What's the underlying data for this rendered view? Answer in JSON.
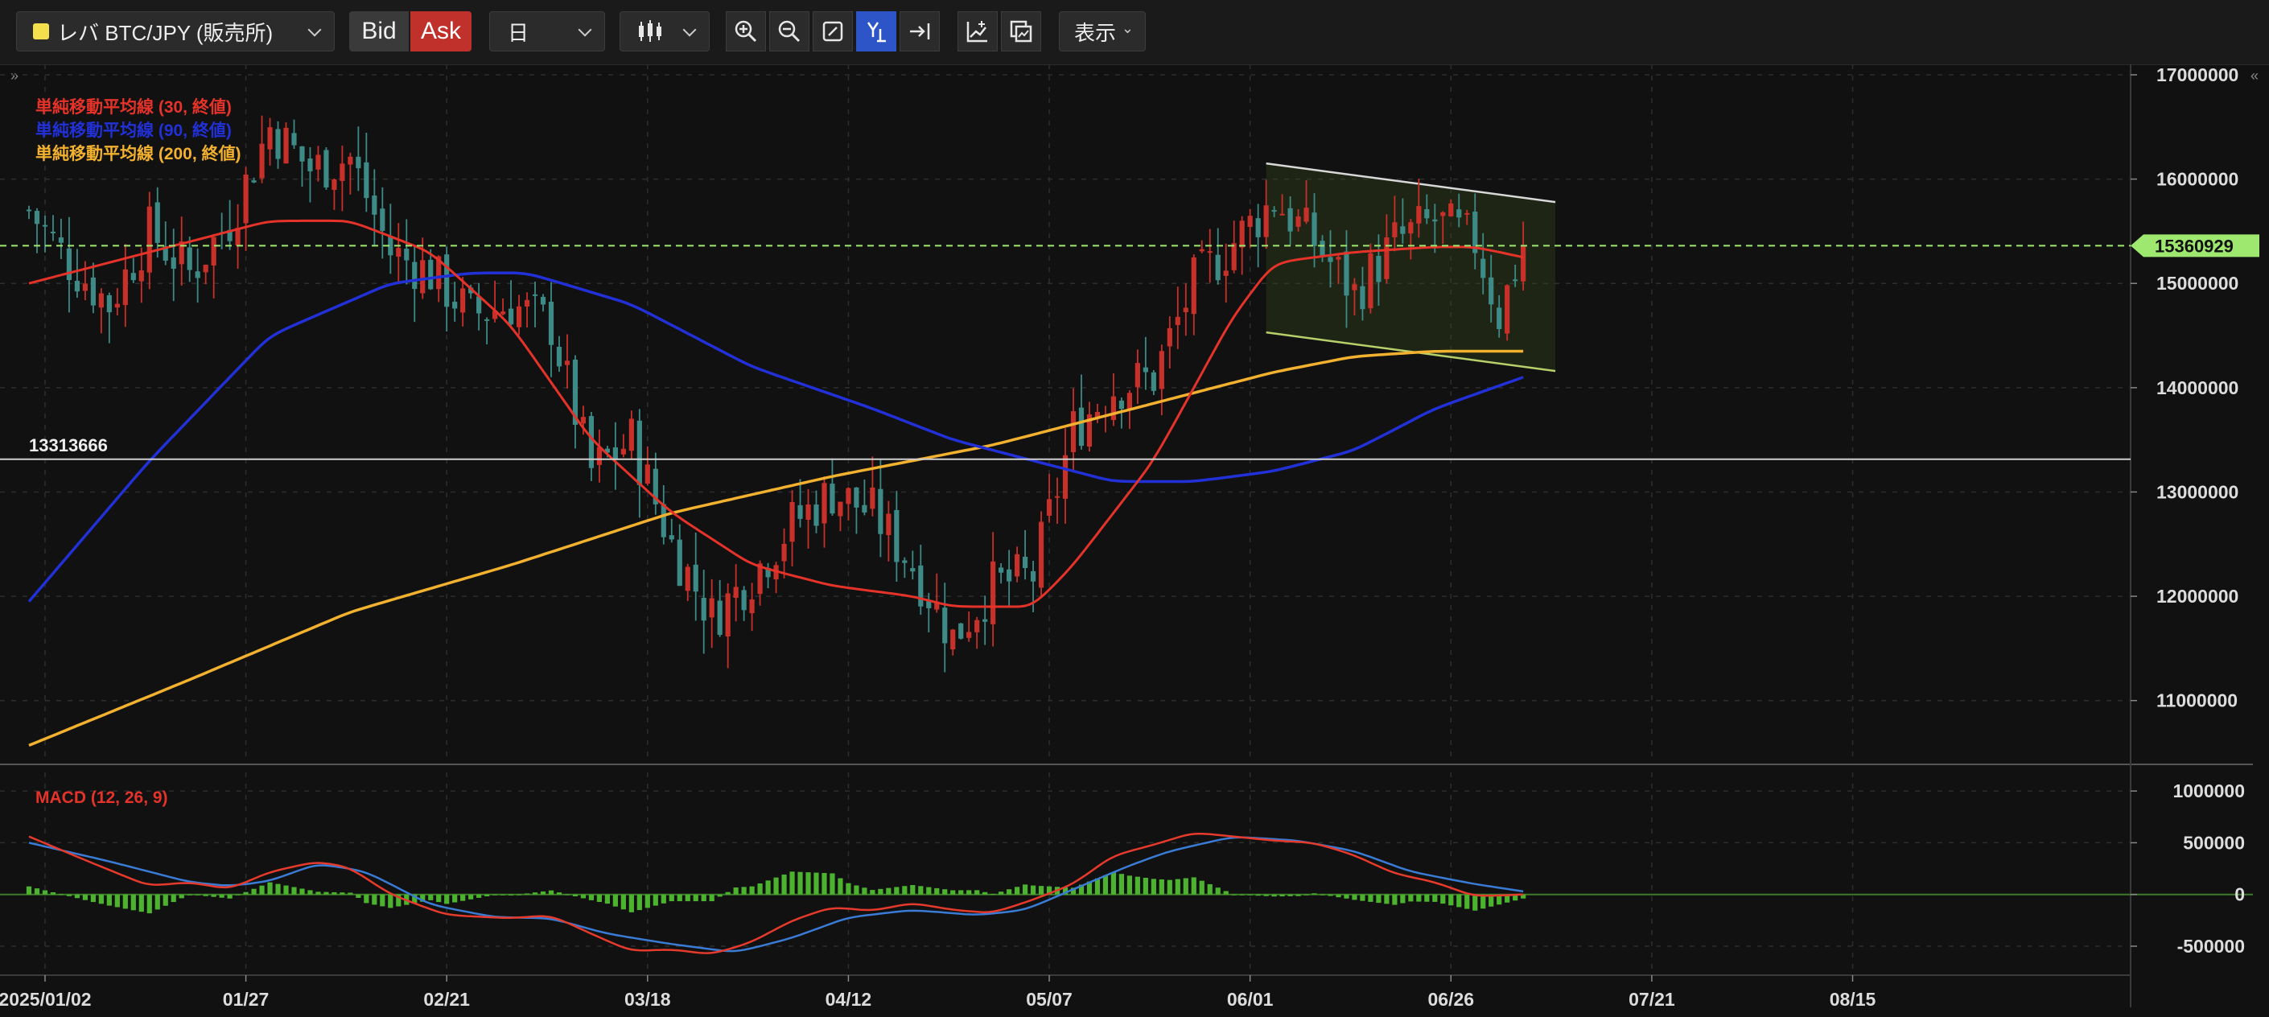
{
  "toolbar": {
    "symbol": "レバ BTC/JPY (販売所)",
    "bid_label": "Bid",
    "ask_label": "Ask",
    "timeframe": "日",
    "display_label": "表示",
    "icons": [
      "candlestick-icon",
      "zoom-in-icon",
      "zoom-out-icon",
      "fit-screen-icon",
      "y-axis-scale-icon",
      "scroll-to-latest-icon",
      "add-indicator-icon",
      "compare-icon"
    ]
  },
  "colors": {
    "bg": "#111111",
    "grid": "#2e2e2e",
    "up": "#c8302a",
    "down": "#3d8a86",
    "sma30": "#e5332a",
    "sma90": "#2230d8",
    "sma200": "#f2b12e",
    "price_line": "#9fe870",
    "hline": "#cfcfcf",
    "macd": "#e53a2c",
    "signal": "#3a7bd5",
    "hist": "#4cb32e"
  },
  "chart_data": [
    {
      "type": "candlestick",
      "title": "",
      "legend": [
        {
          "name": "単純移動平均線 (30, 終値)",
          "color": "#e5332a"
        },
        {
          "name": "単純移動平均線 (90, 終値)",
          "color": "#2230d8"
        },
        {
          "name": "単純移動平均線 (200, 終値)",
          "color": "#f2b12e"
        }
      ],
      "x_ticks": [
        "2025/01/02",
        "01/27",
        "02/21",
        "03/18",
        "04/12",
        "05/07",
        "06/01",
        "06/26",
        "07/21",
        "08/15"
      ],
      "y_ticks": [
        11000000,
        12000000,
        13000000,
        14000000,
        15000000,
        16000000,
        17000000
      ],
      "ylim": [
        10450000,
        17100000
      ],
      "current_price": 15360929,
      "current_price_label": "15360929",
      "horizontal_line": 13313666,
      "horizontal_line_label": "13313666",
      "channel": {
        "upper": [
          {
            "day": 154,
            "price": 16150000
          },
          {
            "day": 190,
            "price": 15780000
          }
        ],
        "lower": [
          {
            "day": 154,
            "price": 14530000
          },
          {
            "day": 190,
            "price": 14160000
          }
        ]
      },
      "close_anchors": [
        [
          0,
          15700000
        ],
        [
          5,
          15200000
        ],
        [
          10,
          14800000
        ],
        [
          15,
          15500000
        ],
        [
          20,
          15100000
        ],
        [
          25,
          15600000
        ],
        [
          30,
          16500000
        ],
        [
          35,
          16100000
        ],
        [
          40,
          16200000
        ],
        [
          45,
          15300000
        ],
        [
          50,
          15100000
        ],
        [
          55,
          14700000
        ],
        [
          60,
          14800000
        ],
        [
          65,
          14600000
        ],
        [
          70,
          13200000
        ],
        [
          75,
          13500000
        ],
        [
          80,
          12500000
        ],
        [
          85,
          11800000
        ],
        [
          90,
          12200000
        ],
        [
          95,
          12700000
        ],
        [
          100,
          13000000
        ],
        [
          105,
          12800000
        ],
        [
          110,
          12300000
        ],
        [
          115,
          11600000
        ],
        [
          120,
          12100000
        ],
        [
          125,
          12200000
        ],
        [
          130,
          13600000
        ],
        [
          135,
          14000000
        ],
        [
          140,
          14100000
        ],
        [
          145,
          15000000
        ],
        [
          150,
          15400000
        ],
        [
          155,
          15800000
        ],
        [
          160,
          15400000
        ],
        [
          165,
          14900000
        ],
        [
          170,
          15400000
        ],
        [
          175,
          15600000
        ],
        [
          180,
          15400000
        ],
        [
          183,
          14700000
        ],
        [
          186,
          15360929
        ]
      ],
      "sma30": [
        [
          0,
          15000000
        ],
        [
          15,
          15300000
        ],
        [
          30,
          15600000
        ],
        [
          40,
          15600000
        ],
        [
          50,
          15300000
        ],
        [
          60,
          14600000
        ],
        [
          70,
          13500000
        ],
        [
          80,
          12800000
        ],
        [
          90,
          12300000
        ],
        [
          100,
          12100000
        ],
        [
          110,
          12000000
        ],
        [
          115,
          11900000
        ],
        [
          125,
          11900000
        ],
        [
          130,
          12300000
        ],
        [
          140,
          13300000
        ],
        [
          145,
          14000000
        ],
        [
          150,
          14700000
        ],
        [
          155,
          15200000
        ],
        [
          165,
          15300000
        ],
        [
          175,
          15350000
        ],
        [
          180,
          15350000
        ],
        [
          186,
          15250000
        ]
      ],
      "sma90": [
        [
          0,
          11950000
        ],
        [
          15,
          13300000
        ],
        [
          30,
          14500000
        ],
        [
          45,
          15000000
        ],
        [
          55,
          15100000
        ],
        [
          62,
          15100000
        ],
        [
          75,
          14800000
        ],
        [
          90,
          14200000
        ],
        [
          105,
          13800000
        ],
        [
          115,
          13500000
        ],
        [
          125,
          13300000
        ],
        [
          135,
          13100000
        ],
        [
          145,
          13100000
        ],
        [
          155,
          13200000
        ],
        [
          165,
          13400000
        ],
        [
          175,
          13800000
        ],
        [
          186,
          14100000
        ]
      ],
      "sma200": [
        [
          0,
          10570000
        ],
        [
          20,
          11200000
        ],
        [
          40,
          11850000
        ],
        [
          60,
          12300000
        ],
        [
          80,
          12800000
        ],
        [
          100,
          13150000
        ],
        [
          120,
          13450000
        ],
        [
          140,
          13850000
        ],
        [
          155,
          14150000
        ],
        [
          165,
          14300000
        ],
        [
          175,
          14350000
        ],
        [
          186,
          14350000
        ]
      ]
    },
    {
      "type": "macd",
      "label": "MACD (12, 26, 9)",
      "y_ticks": [
        -500000,
        0,
        500000,
        1000000
      ],
      "ylim": [
        -780000,
        1180000
      ],
      "macd": [
        [
          0,
          560000
        ],
        [
          8,
          300000
        ],
        [
          15,
          80000
        ],
        [
          20,
          120000
        ],
        [
          25,
          50000
        ],
        [
          30,
          220000
        ],
        [
          36,
          320000
        ],
        [
          40,
          260000
        ],
        [
          45,
          0
        ],
        [
          52,
          -200000
        ],
        [
          60,
          -230000
        ],
        [
          65,
          -200000
        ],
        [
          70,
          -380000
        ],
        [
          75,
          -550000
        ],
        [
          80,
          -530000
        ],
        [
          85,
          -580000
        ],
        [
          90,
          -460000
        ],
        [
          95,
          -250000
        ],
        [
          100,
          -120000
        ],
        [
          105,
          -160000
        ],
        [
          110,
          -80000
        ],
        [
          115,
          -150000
        ],
        [
          120,
          -180000
        ],
        [
          125,
          -50000
        ],
        [
          130,
          100000
        ],
        [
          135,
          380000
        ],
        [
          140,
          480000
        ],
        [
          145,
          600000
        ],
        [
          150,
          560000
        ],
        [
          155,
          520000
        ],
        [
          160,
          500000
        ],
        [
          165,
          380000
        ],
        [
          170,
          200000
        ],
        [
          175,
          120000
        ],
        [
          180,
          -20000
        ],
        [
          186,
          0
        ]
      ],
      "signal": [
        [
          0,
          500000
        ],
        [
          10,
          320000
        ],
        [
          20,
          120000
        ],
        [
          25,
          80000
        ],
        [
          30,
          130000
        ],
        [
          36,
          300000
        ],
        [
          42,
          220000
        ],
        [
          50,
          -100000
        ],
        [
          58,
          -220000
        ],
        [
          65,
          -230000
        ],
        [
          72,
          -380000
        ],
        [
          80,
          -480000
        ],
        [
          88,
          -560000
        ],
        [
          95,
          -420000
        ],
        [
          102,
          -220000
        ],
        [
          110,
          -150000
        ],
        [
          118,
          -200000
        ],
        [
          124,
          -150000
        ],
        [
          130,
          50000
        ],
        [
          137,
          280000
        ],
        [
          142,
          420000
        ],
        [
          150,
          560000
        ],
        [
          158,
          520000
        ],
        [
          165,
          420000
        ],
        [
          172,
          220000
        ],
        [
          180,
          100000
        ],
        [
          186,
          30000
        ]
      ]
    }
  ]
}
